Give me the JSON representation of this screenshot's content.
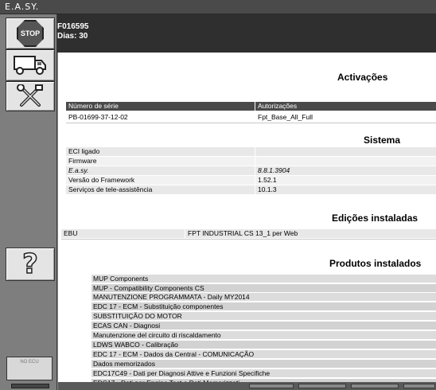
{
  "app": {
    "title": "E.A.SY."
  },
  "sidebar": {
    "stop_label": "STOP",
    "truck_icon": "truck-icon",
    "tools_icon": "tools-icon",
    "help_label": "?",
    "status_label": "NO ECU"
  },
  "header": {
    "line1": "F016595",
    "line2": "Dias: 30"
  },
  "activations": {
    "title": "Activações",
    "columns": [
      "Número de série",
      "Autorizações"
    ],
    "rows": [
      [
        "PB-01699-37-12-02",
        "Fpt_Base_All_Full"
      ]
    ]
  },
  "system": {
    "title": "Sistema",
    "rows": [
      [
        "ECI ligado",
        ""
      ],
      [
        "Firmware",
        ""
      ],
      [
        "E.a.sy.",
        "8.8.1.3904"
      ],
      [
        "Versão do Framework",
        "1.52.1"
      ],
      [
        "Serviços de tele-assistência",
        "10.1.3"
      ]
    ]
  },
  "editions": {
    "title": "Edições instaladas",
    "rows": [
      [
        "EBU",
        "FPT INDUSTRIAL CS 13_1 per Web"
      ]
    ]
  },
  "products": {
    "title": "Produtos instalados",
    "items": [
      "MUP Components",
      "MUP - Compatibility Components CS",
      "MANUTENZIONE PROGRAMMATA - Daily MY2014",
      "EDC 17 - ECM - Substituição componentes",
      "SUBSTITUIÇÃO DO MOTOR",
      "ECAS CAN - Diagnosi",
      "Manutenzione del circuito di riscaldamento",
      "LDWS WABCO - Calibração",
      "EDC 17 - ECM - Dados da Central - COMUNICAÇÃO",
      "Dados memorizados",
      "EDC17C49 - Dati per Diagnosi Attive e Funzioni Specifiche",
      "EDC17 - Dati per Engine Test e Dati Memorizzati"
    ]
  },
  "colors": {
    "header_bg": "#2f2f2f",
    "table_header_bg": "#4a4a4a",
    "sidebar_bg": "#7e7e7e"
  }
}
